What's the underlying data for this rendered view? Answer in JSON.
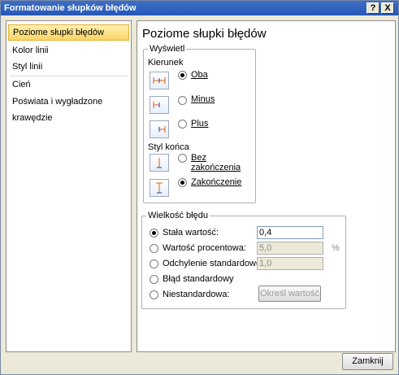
{
  "window": {
    "title": "Formatowanie słupków błędów",
    "help_glyph": "?",
    "close_glyph": "X"
  },
  "nav": {
    "items": [
      {
        "label": "Poziome słupki błędów",
        "active": true
      },
      {
        "label": "Kolor linii"
      },
      {
        "label": "Styl linii"
      },
      {
        "label": "Cień"
      },
      {
        "label": "Poświata i wygładzone krawędzie"
      }
    ]
  },
  "panel": {
    "title": "Poziome słupki błędów",
    "display_group": {
      "legend": "Wyświetl",
      "direction_label": "Kierunek",
      "direction_options": [
        {
          "label": "Oba",
          "checked": true
        },
        {
          "label": "Minus",
          "checked": false
        },
        {
          "label": "Plus",
          "checked": false
        }
      ],
      "end_style_label": "Styl końca",
      "end_style_options": [
        {
          "label": "Bez zakończenia",
          "checked": false
        },
        {
          "label": "Zakończenie",
          "checked": true
        }
      ]
    },
    "amount_group": {
      "legend": "Wielkość błędu",
      "options": [
        {
          "label": "Stała wartość:",
          "checked": true,
          "value": "0,4",
          "enabled": true
        },
        {
          "label": "Wartość procentowa:",
          "checked": false,
          "value": "5,0",
          "enabled": false,
          "suffix": "%"
        },
        {
          "label": "Odchylenie standardowe:",
          "checked": false,
          "value": "1,0",
          "enabled": false
        },
        {
          "label": "Błąd standardowy",
          "checked": false
        },
        {
          "label": "Niestandardowa:",
          "checked": false
        }
      ],
      "specify_button": "Określ wartość"
    }
  },
  "footer": {
    "close_button": "Zamknij"
  }
}
